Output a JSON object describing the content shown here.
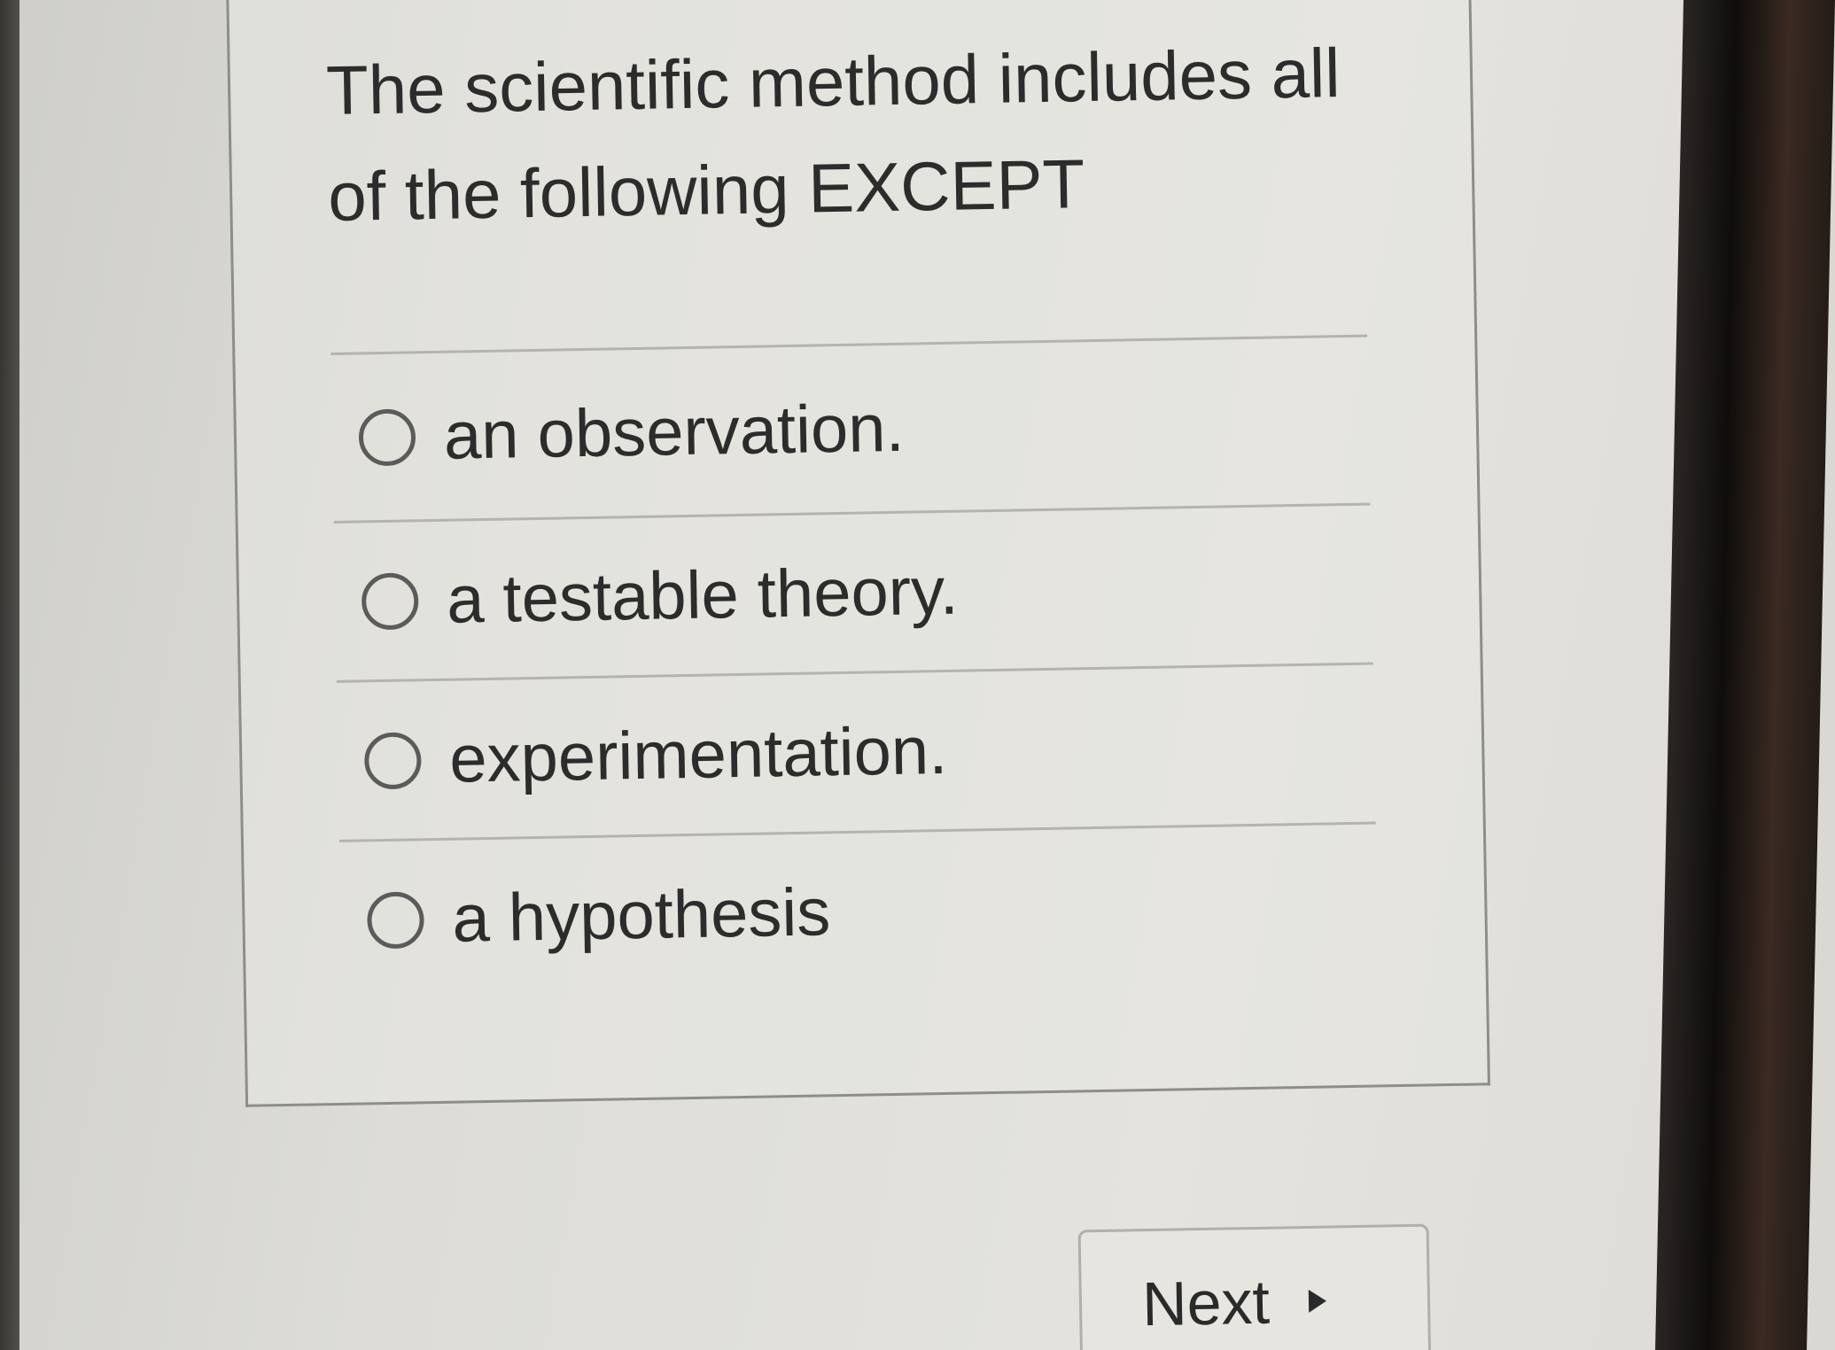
{
  "question": {
    "text_line1": "The scientific method includes all",
    "text_line2": "of the following EXCEPT"
  },
  "options": [
    {
      "label": "an observation.",
      "selected": false
    },
    {
      "label": "a testable theory.",
      "selected": false
    },
    {
      "label": "experimentation.",
      "selected": false
    },
    {
      "label": "a hypothesis",
      "selected": false
    }
  ],
  "next_button": {
    "label": "Next",
    "icon": "triangle-right-icon"
  }
}
